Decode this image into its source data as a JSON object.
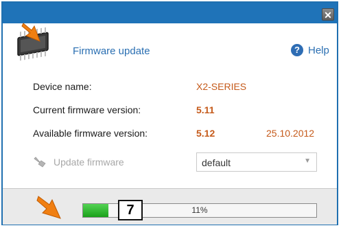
{
  "window": {
    "title": "Firmware update",
    "close_label": "✕"
  },
  "help": {
    "label": "Help"
  },
  "fields": {
    "device_name_label": "Device name:",
    "device_name_value": "X2-SERIES",
    "current_label": "Current firmware version:",
    "current_value": "5.11",
    "available_label": "Available firmware version:",
    "available_value": "5.12",
    "available_date": "25.10.2012"
  },
  "update": {
    "label": "Update firmware"
  },
  "select": {
    "value": "default"
  },
  "progress": {
    "percent_text": "11%",
    "fraction": 0.11
  },
  "badge": {
    "number": "7"
  },
  "colors": {
    "titlebar": "#1f73b8",
    "accent_text": "#c55a1a",
    "link_blue": "#2a6fb2",
    "progress_green": "#2ebf2e"
  },
  "icons": [
    "chip-icon",
    "orange-arrow-icon",
    "close-icon",
    "help-icon",
    "update-hand-icon",
    "dropdown-arrow-icon"
  ]
}
